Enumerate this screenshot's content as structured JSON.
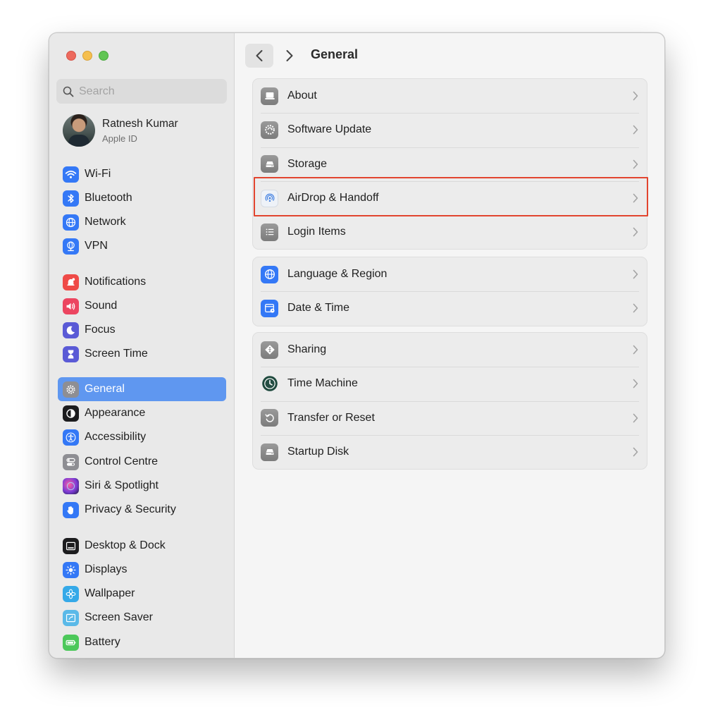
{
  "search": {
    "placeholder": "Search"
  },
  "profile": {
    "name": "Ratnesh Kumar",
    "subtitle": "Apple ID"
  },
  "sidebar": {
    "items": [
      {
        "label": "Wi-Fi",
        "icon": "wifi-icon",
        "color": "#3478f6"
      },
      {
        "label": "Bluetooth",
        "icon": "bluetooth-icon",
        "color": "#3478f6"
      },
      {
        "label": "Network",
        "icon": "globe-icon",
        "color": "#3478f6"
      },
      {
        "label": "VPN",
        "icon": "vpn-icon",
        "color": "#3478f6"
      },
      {
        "label": "Notifications",
        "icon": "bell-icon",
        "color": "#ef4a47"
      },
      {
        "label": "Sound",
        "icon": "speaker-icon",
        "color": "#ec4560"
      },
      {
        "label": "Focus",
        "icon": "moon-icon",
        "color": "#5a5ad6"
      },
      {
        "label": "Screen Time",
        "icon": "hourglass-icon",
        "color": "#5a5ad6"
      },
      {
        "label": "General",
        "icon": "gear-icon",
        "color": "#8e8e93",
        "active": true
      },
      {
        "label": "Appearance",
        "icon": "appearance-icon",
        "color": "#1c1c1e"
      },
      {
        "label": "Accessibility",
        "icon": "accessibility-icon",
        "color": "#3478f6"
      },
      {
        "label": "Control Centre",
        "icon": "toggles-icon",
        "color": "#8e8e93"
      },
      {
        "label": "Siri & Spotlight",
        "icon": "siri-icon",
        "color": "#3b1f5e"
      },
      {
        "label": "Privacy & Security",
        "icon": "hand-icon",
        "color": "#3478f6"
      },
      {
        "label": "Desktop & Dock",
        "icon": "dock-icon",
        "color": "#1c1c1e"
      },
      {
        "label": "Displays",
        "icon": "sun-icon",
        "color": "#3478f6"
      },
      {
        "label": "Wallpaper",
        "icon": "flower-icon",
        "color": "#35a9e8"
      },
      {
        "label": "Screen Saver",
        "icon": "screensaver-icon",
        "color": "#5ab9e8"
      },
      {
        "label": "Battery",
        "icon": "battery-icon",
        "color": "#4cc85a"
      }
    ]
  },
  "header": {
    "title": "General"
  },
  "groups": [
    {
      "rows": [
        {
          "label": "About",
          "icon": "laptop-icon"
        },
        {
          "label": "Software Update",
          "icon": "software-update-icon"
        },
        {
          "label": "Storage",
          "icon": "storage-icon"
        },
        {
          "label": "AirDrop & Handoff",
          "icon": "airdrop-icon",
          "highlighted": true
        },
        {
          "label": "Login Items",
          "icon": "list-icon"
        }
      ]
    },
    {
      "rows": [
        {
          "label": "Language & Region",
          "icon": "globe-icon"
        },
        {
          "label": "Date & Time",
          "icon": "calendar-clock-icon"
        }
      ]
    },
    {
      "rows": [
        {
          "label": "Sharing",
          "icon": "sharing-icon"
        },
        {
          "label": "Time Machine",
          "icon": "time-machine-icon"
        },
        {
          "label": "Transfer or Reset",
          "icon": "reset-icon"
        },
        {
          "label": "Startup Disk",
          "icon": "disk-icon"
        }
      ]
    }
  ],
  "colors": {
    "accent": "#5f97f0",
    "highlight_border": "#e2452f"
  }
}
